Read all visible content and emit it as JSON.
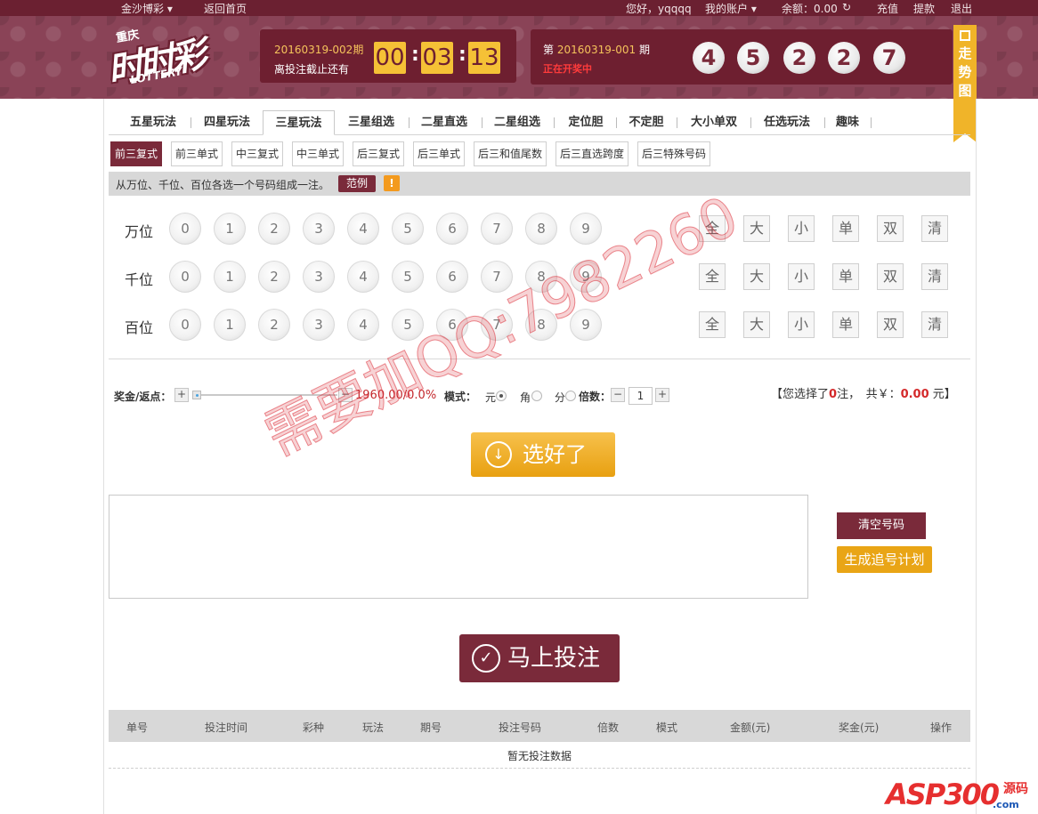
{
  "topbar": {
    "site_name": "金沙博彩",
    "home_link": "返回首页",
    "greeting": "您好，yqqqq",
    "my_account": "我的账户",
    "balance": "余额：0.00",
    "recharge": "充值",
    "withdraw": "提款",
    "logout": "退出"
  },
  "logo": {
    "region": "重庆",
    "title": "时时彩",
    "subtitle": "LOTTERY"
  },
  "countdown": {
    "issue": "20160319-002期",
    "note": "离投注截止还有",
    "hh": "00",
    "mm": "03",
    "ss": "13"
  },
  "result": {
    "prefix": "第",
    "issue": "20160319-001",
    "suffix": "期",
    "status": "正在开奖中",
    "balls": [
      "4",
      "5",
      "2",
      "2",
      "7"
    ]
  },
  "trend": {
    "chars": [
      "走",
      "势",
      "图"
    ]
  },
  "tabs": [
    {
      "label": "五星玩法"
    },
    {
      "label": "四星玩法"
    },
    {
      "label": "三星玩法"
    },
    {
      "label": "三星组选"
    },
    {
      "label": "二星直选"
    },
    {
      "label": "二星组选"
    },
    {
      "label": "定位胆"
    },
    {
      "label": "不定胆"
    },
    {
      "label": "大小单双"
    },
    {
      "label": "任选玩法"
    },
    {
      "label": "趣味"
    }
  ],
  "subtabs": [
    {
      "label": "前三复式"
    },
    {
      "label": "前三单式"
    },
    {
      "label": "中三复式"
    },
    {
      "label": "中三单式"
    },
    {
      "label": "后三复式"
    },
    {
      "label": "后三单式"
    },
    {
      "label": "后三和值尾数"
    },
    {
      "label": "后三直选跨度"
    },
    {
      "label": "后三特殊号码"
    }
  ],
  "hint": {
    "text": "从万位、千位、百位各选一个号码组成一注。",
    "example": "范例",
    "warn": "!"
  },
  "rows": [
    {
      "label": "万位"
    },
    {
      "label": "千位"
    },
    {
      "label": "百位"
    }
  ],
  "digits": [
    "0",
    "1",
    "2",
    "3",
    "4",
    "5",
    "6",
    "7",
    "8",
    "9"
  ],
  "filters": [
    "全",
    "大",
    "小",
    "单",
    "双",
    "清"
  ],
  "controls": {
    "prize_label": "奖金/返点：",
    "plus": "+",
    "minus": "−",
    "rebate": "1960.00/0.0%",
    "mode_label": "模式：",
    "mode_yuan": "元",
    "mode_jiao": "角",
    "mode_fen": "分",
    "multiple_label": "倍数：",
    "multiple_value": "1"
  },
  "summary": {
    "pre": "【您选择了",
    "count": "0",
    "mid": "注，　共￥：",
    "amount": "0.00",
    "post": "元】"
  },
  "buttons": {
    "choose": "选好了",
    "clear": "清空号码",
    "plan": "生成追号计划",
    "bet": "马上投注"
  },
  "table": {
    "headers": [
      "单号",
      "投注时间",
      "彩种",
      "玩法",
      "期号",
      "投注号码",
      "倍数",
      "模式",
      "金额(元)",
      "奖金(元)",
      "操作"
    ],
    "empty": "暂无投注数据"
  },
  "watermark": "需要加QQ:7982260",
  "corner_logo": {
    "brand": "ASP300",
    "tag": "源码",
    "domain": ".com"
  }
}
